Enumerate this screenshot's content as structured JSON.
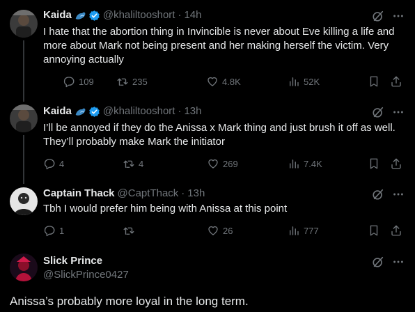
{
  "tweets": [
    {
      "name": "Kaida",
      "handle": "@khaliltooshort",
      "separator": "·",
      "time": "14h",
      "text": "I hate that the abortion thing in Invincible is never about Eve killing a life and more about Mark not being present and her making herself the victim. Very annoying actually",
      "replies": "109",
      "reposts": "235",
      "likes": "4.8K",
      "views": "52K"
    },
    {
      "name": "Kaida",
      "handle": "@khaliltooshort",
      "separator": "·",
      "time": "13h",
      "text": "I’ll be annoyed if they do the Anissa x Mark thing and just brush it off as well. They’ll probably make Mark the initiator",
      "replies": "4",
      "reposts": "4",
      "likes": "269",
      "views": "7.4K"
    },
    {
      "name": "Captain Thack",
      "handle": "@CaptThack",
      "separator": "·",
      "time": "13h",
      "text": "Tbh I would prefer him being with Anissa at this point",
      "replies": "1",
      "reposts": "",
      "likes": "26",
      "views": "777"
    }
  ],
  "main_tweet": {
    "name": "Slick Prince",
    "handle": "@SlickPrince0427",
    "text": "Anissa’s probably more loyal in the long term."
  },
  "colors": {
    "background": "#000000",
    "text": "#e7e9ea",
    "muted": "#71767b",
    "verified": "#1d9bf0"
  },
  "icons": [
    "reply-icon",
    "repost-icon",
    "like-icon",
    "views-icon",
    "bookmark-icon",
    "share-icon",
    "grok-icon",
    "more-icon",
    "verified-icon",
    "flex-emoji-icon"
  ]
}
